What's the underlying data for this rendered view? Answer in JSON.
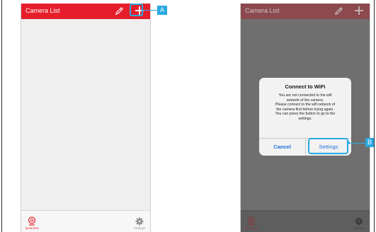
{
  "left_screen": {
    "header": {
      "title": "Camera List"
    },
    "tabbar": {
      "tab_cameras": "Ipcamera",
      "tab_settings": "Settings"
    },
    "callout_label": "A"
  },
  "right_screen": {
    "header": {
      "title": "Camera List"
    },
    "dialog": {
      "title": "Connect to WiFi",
      "message": "You are not connected to the wifi\nnetwork of the camera.\nPlease connect to the wifi network of\nthe camera first before trying again.\nYou can press the button to go to the\nsettings.",
      "cancel_label": "Cancel",
      "settings_label": "Settings"
    },
    "tabbar": {
      "tab_cameras": "Ipcamera",
      "tab_settings": "Settings"
    },
    "callout_label": "B"
  },
  "colors": {
    "brand_red": "#e61e2b",
    "callout_blue": "#29a9e0",
    "ios_blue": "#1e6fd9"
  },
  "icons": [
    "pencil-icon",
    "plus-icon",
    "camera-icon",
    "gear-icon"
  ]
}
